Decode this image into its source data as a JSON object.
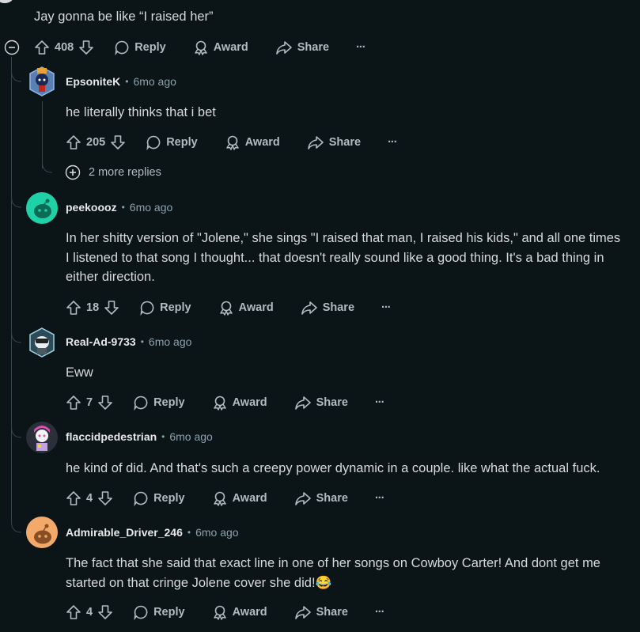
{
  "root_comment": {
    "text": "Jay gonna be like “I raised her”",
    "votes": "408"
  },
  "labels": {
    "reply": "Reply",
    "award": "Award",
    "share": "Share",
    "more": "···",
    "dot": "•"
  },
  "comments": [
    {
      "author": "EpsoniteK",
      "time": "6mo ago",
      "text": "he literally thinks that i bet",
      "votes": "205",
      "more_replies": "2 more replies",
      "avatar_color": "#1e3a8a"
    },
    {
      "author": "peekoooz",
      "time": "6mo ago",
      "text_lines": [
        "In her shitty version of \"Jolene,\" she sings \"I raised that man, I raised his kids,\" and all one times",
        "I listened to that song I thought... that doesn't really sound like a good thing. It's a bad thing in",
        "either direction."
      ],
      "votes": "18",
      "avatar_color": "#1fd1a6"
    },
    {
      "author": "Real-Ad-9733",
      "time": "6mo ago",
      "text": "Eww",
      "votes": "7",
      "avatar_color": "#7fb2c9"
    },
    {
      "author": "flaccidpedestrian",
      "time": "6mo ago",
      "text": "he kind of did. And that's such a creepy power dynamic in a couple. like what the actual fuck.",
      "votes": "4",
      "avatar_color": "#2a2f3a"
    },
    {
      "author": "Admirable_Driver_246",
      "time": "6mo ago",
      "text_lines": [
        "The fact that she said that exact line in one of her songs on Cowboy Carter! And dont get me",
        "started on that cringe Jolene cover she did!😂"
      ],
      "votes": "4",
      "avatar_color": "#f2a96a"
    }
  ]
}
